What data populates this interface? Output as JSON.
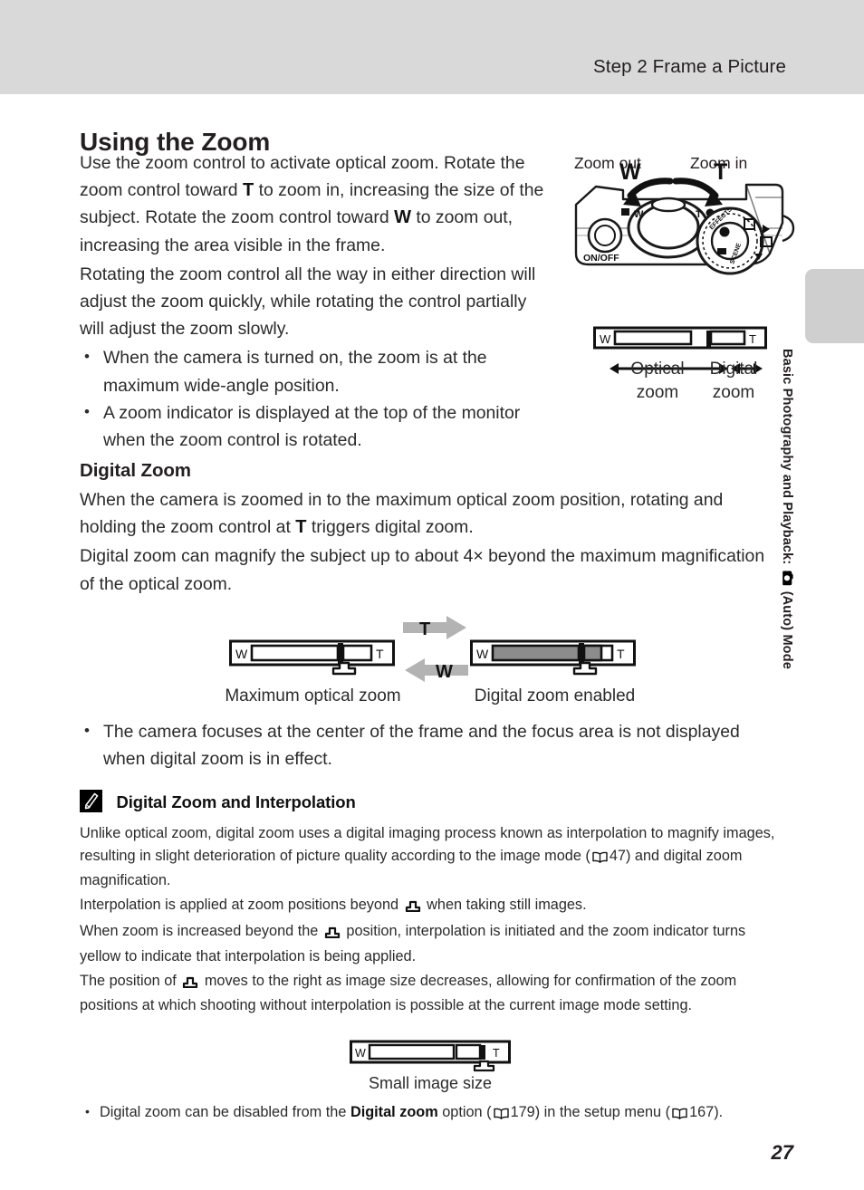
{
  "header": {
    "title": "Step 2 Frame a Picture"
  },
  "side_tab": {
    "chapter_text_before": "Basic Photography and Playback:",
    "chapter_icon": "camera-auto-icon",
    "chapter_text_after": "(Auto) Mode"
  },
  "page": {
    "heading": "Using the Zoom",
    "number": "27"
  },
  "intro": {
    "para1_a": "Use the zoom control to activate optical zoom. Rotate the zoom control toward ",
    "para1_t": "T",
    "para1_b": " to zoom in, increasing the size of the subject. Rotate the zoom control toward ",
    "para1_w": "W",
    "para1_c": " to zoom out, increasing the area visible in the frame.",
    "para2": "Rotating the zoom control all the way in either direction will adjust the zoom quickly, while rotating the control partially will adjust the zoom slowly.",
    "bullets": [
      "When the camera is turned on, the zoom is at the maximum wide-angle position.",
      "A zoom indicator is displayed at the top of the monitor when the zoom control is rotated."
    ]
  },
  "camera_figure": {
    "zoom_out_label": "Zoom out",
    "zoom_in_label": "Zoom in",
    "w_label": "W",
    "t_label": "T",
    "onoff_label": "ON/OFF",
    "dial_labels": [
      "EFFECTS",
      "SCENE"
    ]
  },
  "indicator_figure": {
    "w_label": "W",
    "t_label": "T",
    "optical_label_line1": "Optical",
    "optical_label_line2": "zoom",
    "digital_label_line1": "Digital",
    "digital_label_line2": "zoom"
  },
  "digital_zoom": {
    "heading": "Digital Zoom",
    "para1_a": "When the camera is zoomed in to the maximum optical zoom position, rotating and holding the zoom control at ",
    "para1_t": "T",
    "para1_b": " triggers digital zoom.",
    "para2": "Digital zoom can magnify the subject up to about 4× beyond the maximum magnification of the optical zoom."
  },
  "zoom_state_figure": {
    "t_arrow_label": "T",
    "w_arrow_label": "W",
    "left_caption": "Maximum optical zoom",
    "right_caption": "Digital zoom enabled",
    "w_label": "W",
    "t_label": "T"
  },
  "focus_bullet": "The camera focuses at the center of the frame and the focus area is not displayed when digital zoom is in effect.",
  "note": {
    "icon": "pencil-note-icon",
    "title": "Digital Zoom and Interpolation",
    "para1_a": "Unlike optical zoom, digital zoom uses a digital imaging process known as interpolation to magnify images, resulting in slight deterioration of picture quality according to the image mode (",
    "para1_ref": "47",
    "para1_b": ") and digital zoom magnification.",
    "para2_a": "Interpolation is applied at zoom positions beyond ",
    "para2_b": " when taking still images.",
    "para3_a": "When zoom is increased beyond the ",
    "para3_b": " position, interpolation is initiated and the zoom indicator turns yellow to indicate that interpolation is being applied.",
    "para4_a": "The position of ",
    "para4_b": " moves to the right as image size decreases, allowing for confirmation of the zoom positions at which shooting without interpolation is possible at the current image mode setting.",
    "small_image_caption": "Small image size",
    "small_w_label": "W",
    "small_t_label": "T",
    "bullet_a": "Digital zoom can be disabled from the ",
    "bullet_bold": "Digital zoom",
    "bullet_b": " option (",
    "bullet_ref1": "179",
    "bullet_c": ") in the setup menu (",
    "bullet_ref2": "167",
    "bullet_d": ")."
  },
  "colors": {
    "header_band": "#d9d9d9",
    "side_tab": "#cfcfcf",
    "bar_fill": "#8c8c8c",
    "arrow_gray": "#b3b3b3",
    "text": "#2b2b2b"
  }
}
